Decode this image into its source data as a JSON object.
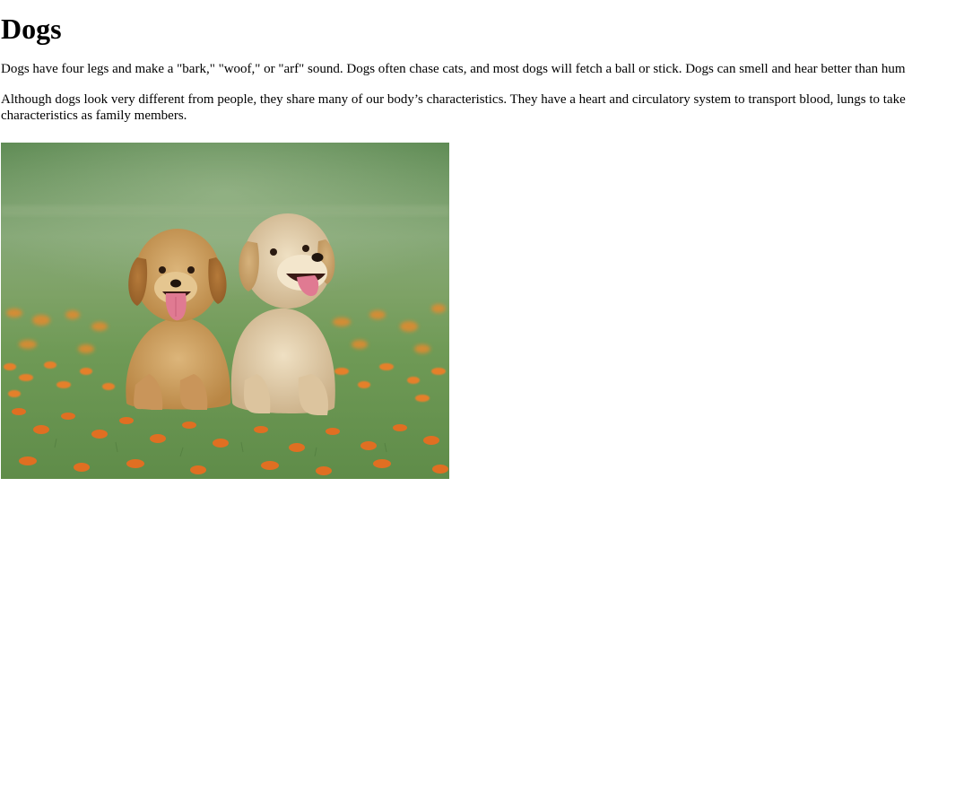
{
  "page": {
    "heading": "Dogs",
    "paragraph_1": "Dogs have four legs and make a \"bark,\" \"woof,\" or \"arf\" sound. Dogs often chase cats, and most dogs will fetch a ball or stick. Dogs can smell and hear better than hum",
    "paragraph_2_line_1": "Although dogs look very different from people, they share many of our body’s characteristics. They have a heart and circulatory system to transport blood, lungs to take",
    "paragraph_2_line_2": "characteristics as family members."
  },
  "image": {
    "subject": "two-golden-retriever-puppies-in-flower-field",
    "colors": {
      "grass_dark": "#5f8a55",
      "grass_light": "#7fa36a",
      "flower_orange": "#e0772a",
      "puppy_left": "#c99a5a",
      "puppy_right": "#d9c09a",
      "tongue": "#e07a92"
    }
  }
}
